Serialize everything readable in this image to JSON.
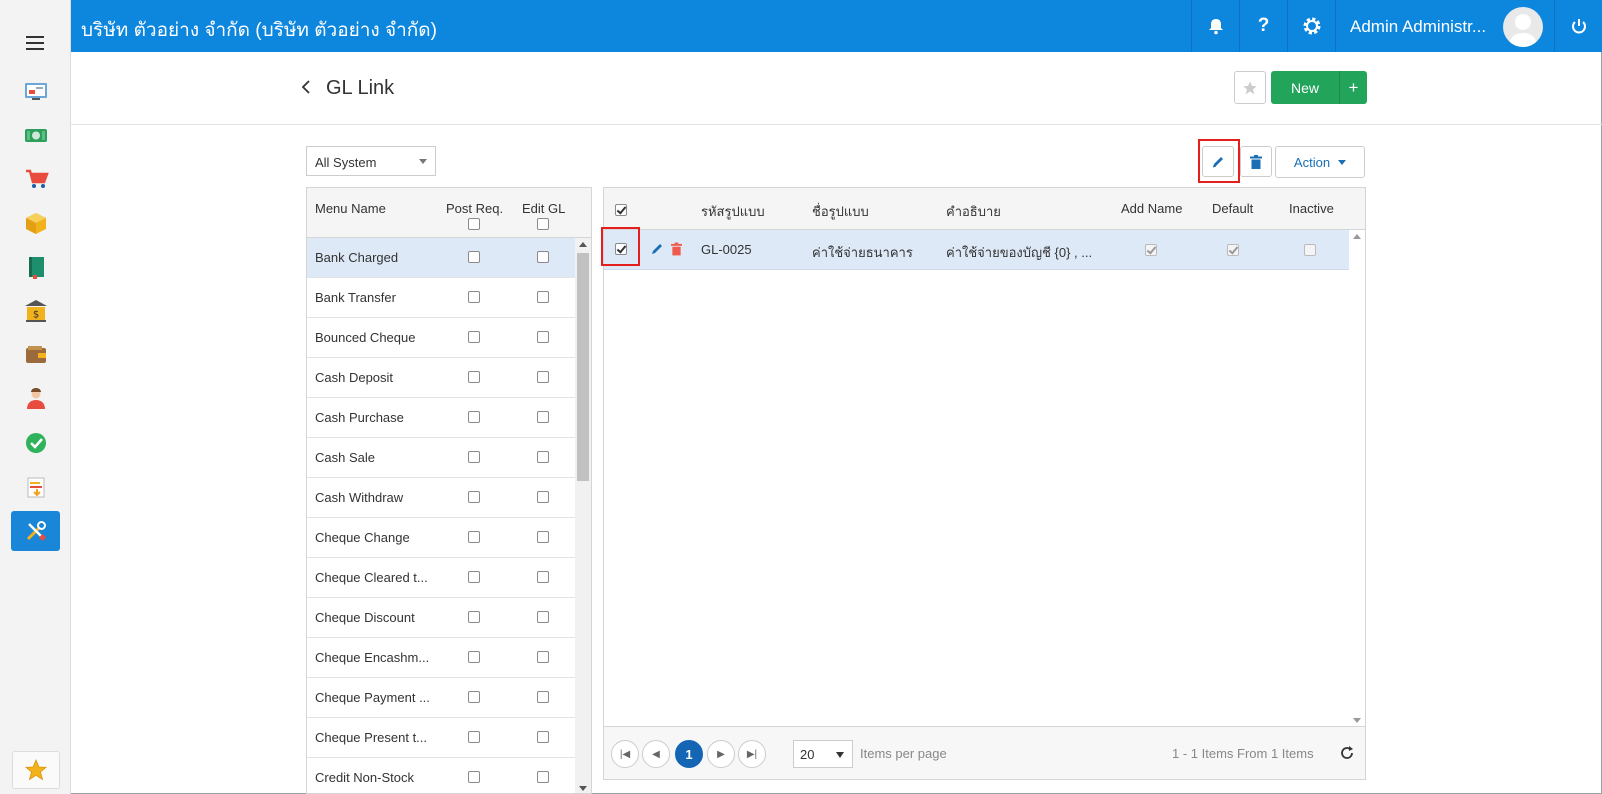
{
  "app": {
    "company": "บริษัท ตัวอย่าง จำกัด (บริษัท ตัวอย่าง จำกัด)",
    "user": "Admin Administr...",
    "brand_color": "#0d86dd",
    "icons": [
      "bell-icon",
      "help-icon",
      "gear-icon",
      "power-icon"
    ]
  },
  "sidebar": {
    "items": [
      {
        "name": "dashboard-icon"
      },
      {
        "name": "finance-icon"
      },
      {
        "name": "cart-icon"
      },
      {
        "name": "box-icon"
      },
      {
        "name": "book-icon"
      },
      {
        "name": "bank-icon"
      },
      {
        "name": "wallet-icon"
      },
      {
        "name": "people-icon"
      },
      {
        "name": "approve-icon"
      },
      {
        "name": "import-icon"
      },
      {
        "name": "tools-icon",
        "active": true
      }
    ],
    "favorite": "star-icon"
  },
  "header": {
    "title": "GL Link",
    "new_label": "New",
    "plus": "+"
  },
  "toolbar": {
    "system_select": "All System",
    "action_label": "Action"
  },
  "menu_grid": {
    "columns": {
      "name": "Menu Name",
      "post": "Post Req.",
      "edit": "Edit GL"
    },
    "rows": [
      {
        "name": "Bank Charged",
        "selected": true
      },
      {
        "name": "Bank Transfer"
      },
      {
        "name": "Bounced Cheque"
      },
      {
        "name": "Cash Deposit"
      },
      {
        "name": "Cash Purchase"
      },
      {
        "name": "Cash Sale"
      },
      {
        "name": "Cash Withdraw"
      },
      {
        "name": "Cheque Change"
      },
      {
        "name": "Cheque Cleared t..."
      },
      {
        "name": "Cheque Discount"
      },
      {
        "name": "Cheque Encashm..."
      },
      {
        "name": "Cheque Payment ..."
      },
      {
        "name": "Cheque Present t..."
      },
      {
        "name": "Credit Non-Stock"
      }
    ]
  },
  "gl_grid": {
    "columns": {
      "code": "รหัสรูปแบบ",
      "name": "ชื่อรูปแบบ",
      "desc": "คำอธิบาย",
      "add_name": "Add Name",
      "default": "Default",
      "inactive": "Inactive"
    },
    "rows": [
      {
        "code": "GL-0025",
        "name": "ค่าใช้จ่ายธนาคาร",
        "desc": "ค่าใช้จ่ายของบัญชี {0} , ...",
        "add_name": true,
        "default": true,
        "inactive": false
      }
    ]
  },
  "pager": {
    "current_page": "1",
    "page_size": "20",
    "items_per_page": "Items per page",
    "info": "1 - 1 Items From 1 Items"
  }
}
